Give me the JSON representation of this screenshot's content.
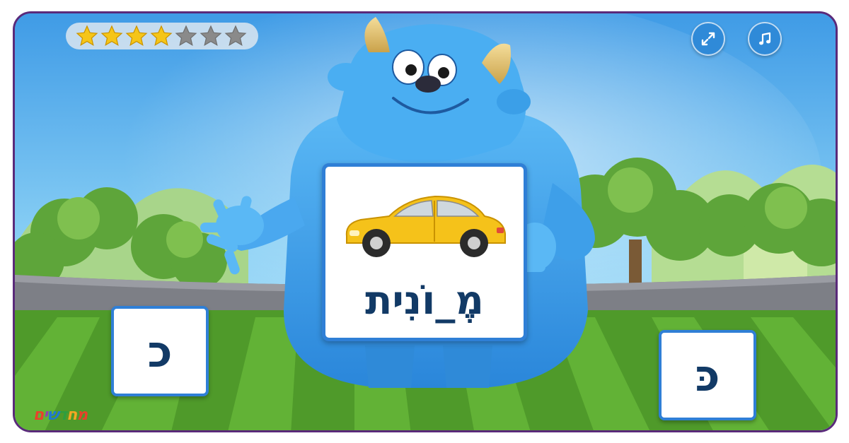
{
  "rating": {
    "filled_stars": 4,
    "total_stars": 7,
    "filled_color": "#f5c518",
    "empty_color": "#8a8a8a"
  },
  "controls": {
    "fullscreen_icon": "expand-arrows-icon",
    "music_icon": "music-note-icon"
  },
  "question_card": {
    "picture": "yellow-car",
    "word": "מֶ_וֹנִית"
  },
  "answers": [
    {
      "letter": "כ"
    },
    {
      "letter": "כּ"
    }
  ],
  "brand": {
    "logo_text": "מחדשים"
  },
  "colors": {
    "tile_border": "#2f7fd6",
    "text": "#123a66",
    "frame_border": "#5a2a7a"
  }
}
